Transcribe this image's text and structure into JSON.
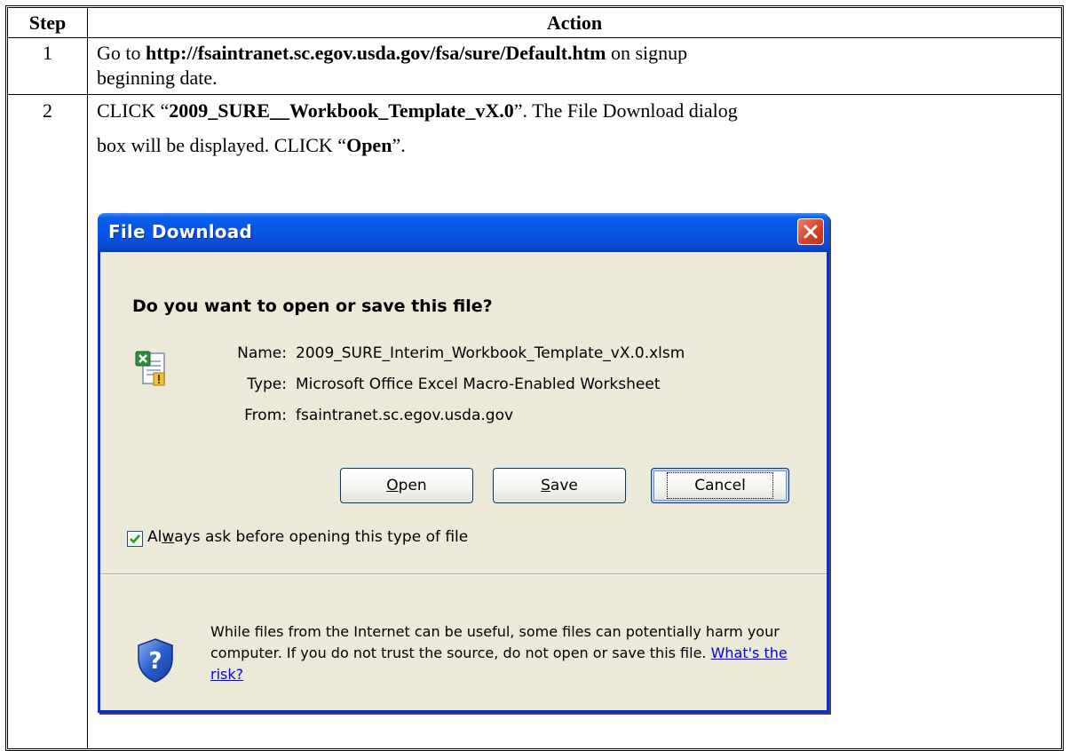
{
  "table": {
    "headers": {
      "step": "Step",
      "action": "Action"
    },
    "rows": [
      {
        "step": "1",
        "line1": [
          "Go to ",
          "http://fsaintranet.sc.egov.usda.gov/fsa/sure/Default.htm",
          " on signup"
        ],
        "line2": "beginning date."
      },
      {
        "step": "2",
        "line1": [
          "CLICK “",
          "2009_SURE__Workbook_Template_vX.0",
          "”.  The File Download dialog"
        ],
        "line2": [
          "box will be displayed.  CLICK “",
          "Open",
          "”."
        ]
      }
    ]
  },
  "dialog": {
    "title": "File Download",
    "question": "Do you want to open or save this file?",
    "file": {
      "name_label": "Name:",
      "name_value": "2009_SURE_Interim_Workbook_Template_vX.0.xlsm",
      "type_label": "Type:",
      "type_value": "Microsoft Office Excel Macro-Enabled Worksheet",
      "from_label": "From:",
      "from_value": "fsaintranet.sc.egov.usda.gov"
    },
    "buttons": {
      "open": {
        "mnemonic": "O",
        "rest": "pen"
      },
      "save": {
        "mnemonic": "S",
        "rest": "ave"
      },
      "cancel": "Cancel"
    },
    "checkbox": {
      "checked": true,
      "pre": "Al",
      "mnemonic": "w",
      "post": "ays ask before opening this type of file"
    },
    "warning": {
      "text": "While files from the Internet can be useful, some files can potentially harm your computer. If you do not trust the source, do not open or save this file. ",
      "link": "What's the risk?"
    },
    "colors": {
      "titlebar": "#0554e3",
      "face": "#ece9d8",
      "close": "#d9452d",
      "link": "#0000ee"
    }
  }
}
